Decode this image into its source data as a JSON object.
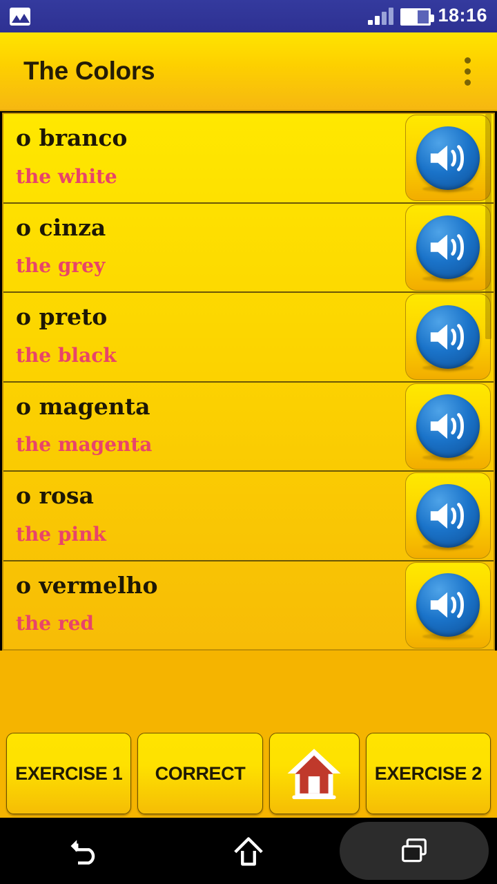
{
  "status_bar": {
    "notification_icon": "gallery-icon",
    "signal_icon": "signal-bars-icon",
    "battery_icon": "battery-icon",
    "time": "18:16"
  },
  "app_bar": {
    "title": "The Colors",
    "overflow_icon": "overflow-menu-icon"
  },
  "list": {
    "rows": [
      {
        "term": "o branco",
        "translation": "the white",
        "speaker_icon": "speaker-icon"
      },
      {
        "term": "o cinza",
        "translation": "the grey",
        "speaker_icon": "speaker-icon"
      },
      {
        "term": "o preto",
        "translation": "the black",
        "speaker_icon": "speaker-icon"
      },
      {
        "term": "o magenta",
        "translation": "the magenta",
        "speaker_icon": "speaker-icon"
      },
      {
        "term": "o rosa",
        "translation": "the pink",
        "speaker_icon": "speaker-icon"
      },
      {
        "term": "o vermelho",
        "translation": "the red",
        "speaker_icon": "speaker-icon"
      }
    ]
  },
  "bottom_bar": {
    "exercise1_label": "EXERCISE 1",
    "correct_label": "CORRECT",
    "home_icon": "home-icon",
    "exercise2_label": "EXERCISE 2"
  },
  "nav_bar": {
    "back_icon": "back-arrow-icon",
    "home_icon": "home-outline-icon",
    "recents_icon": "recents-icon"
  },
  "colors": {
    "status_bar": "#2e3192",
    "app_bar_top": "#ffe400",
    "app_bar_bottom": "#f6b711",
    "list_top": "#ffe800",
    "list_bottom": "#f7bc06",
    "term_text": "#1d1705",
    "translation_text": "#e8446a",
    "speaker_blue": "#1a73c9",
    "home_red": "#c0392b",
    "nav_bar": "#000000"
  }
}
